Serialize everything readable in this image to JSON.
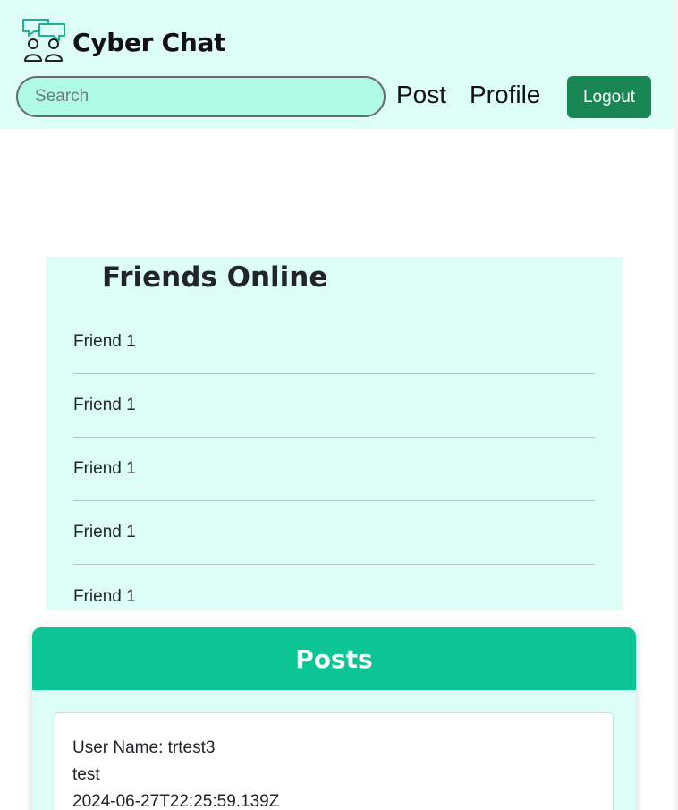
{
  "app": {
    "title": "Cyber Chat",
    "logo_icon": "chat-people-icon"
  },
  "header": {
    "search_placeholder": "Search",
    "nav": {
      "post": "Post",
      "profile": "Profile"
    },
    "logout_label": "Logout"
  },
  "colors": {
    "header_bg": "#ddfef7",
    "search_bg": "#b0fbe6",
    "logout_bg": "#198754",
    "posts_header_bg": "#0cc594"
  },
  "friends": {
    "title": "Friends Online",
    "items": [
      "Friend 1",
      "Friend 1",
      "Friend 1",
      "Friend 1",
      "Friend 1"
    ]
  },
  "posts": {
    "title": "Posts",
    "items": [
      {
        "username_line": "User Name: trtest3",
        "content": "test",
        "timestamp": "2024-06-27T22:25:59.139Z"
      }
    ]
  }
}
